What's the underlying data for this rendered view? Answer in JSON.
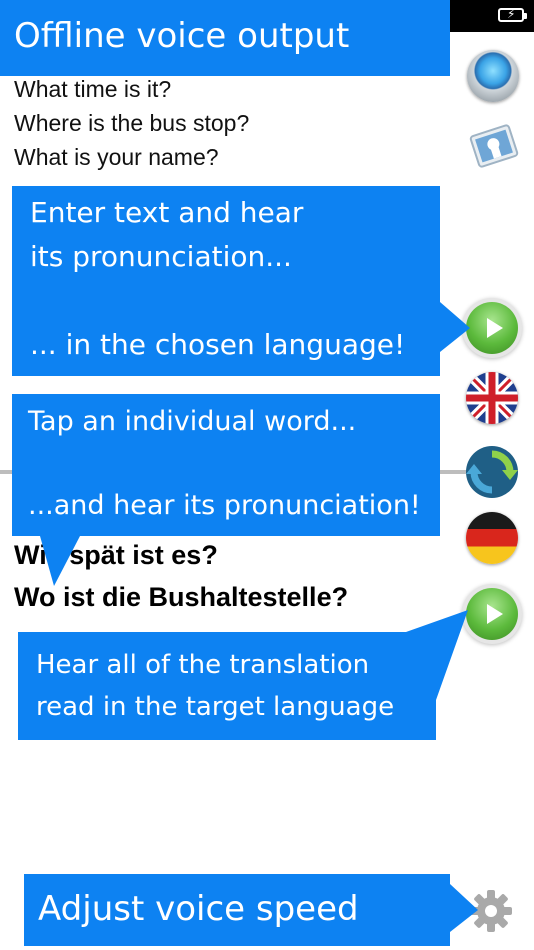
{
  "status_bar": {
    "battery_icon": "battery-charging-icon"
  },
  "source_text": {
    "lines": [
      "What time is it?",
      "Where is the bus stop?",
      "What is your name?"
    ]
  },
  "target_text": {
    "lines": [
      "Wie spät ist es?",
      "Wo ist die Bushaltestelle?"
    ]
  },
  "callouts": {
    "title": "Offline voice output",
    "enter_line1": "Enter text and hear",
    "enter_line2": "its pronunciation...",
    "enter_line3": "... in the chosen language!",
    "tap_line1": "Tap an individual word...",
    "tap_line2": "...and hear its pronunciation!",
    "hear_line1": "Hear all of the translation",
    "hear_line2": "read in the target language",
    "speed": "Adjust voice speed"
  },
  "colors": {
    "callout_blue": "#0d82f2",
    "divider": "#bdbdbd"
  },
  "icons": {
    "microphone": "microphone-icon",
    "camera": "camera-icon",
    "play": "play-icon",
    "flag_source": "uk-flag-icon",
    "swap": "swap-languages-icon",
    "flag_target": "germany-flag-icon",
    "settings": "gear-icon"
  }
}
